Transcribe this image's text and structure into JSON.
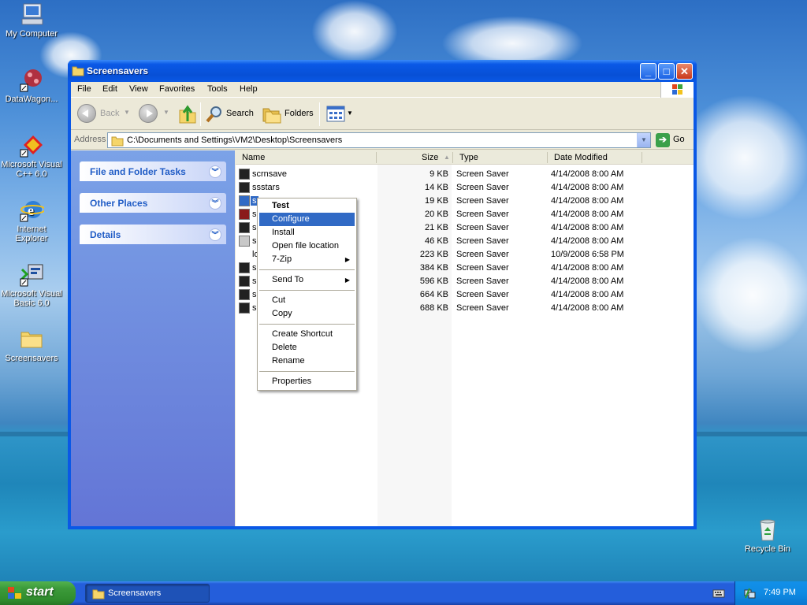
{
  "desktop": {
    "icons": [
      {
        "label": "My Computer"
      },
      {
        "label": "DataWagon..."
      },
      {
        "label": "Microsoft Visual C++ 6.0"
      },
      {
        "label": "Internet Explorer"
      },
      {
        "label": "Microsoft Visual Basic 6.0"
      },
      {
        "label": "Screensavers"
      },
      {
        "label": "Recycle Bin"
      }
    ]
  },
  "window": {
    "title": "Screensavers",
    "menu": [
      "File",
      "Edit",
      "View",
      "Favorites",
      "Tools",
      "Help"
    ],
    "toolbar": {
      "back": "Back",
      "search": "Search",
      "folders": "Folders"
    },
    "address": {
      "label": "Address",
      "value": "C:\\Documents and Settings\\VM2\\Desktop\\Screensavers",
      "go": "Go"
    },
    "tasks": [
      {
        "title": "File and Folder Tasks"
      },
      {
        "title": "Other Places"
      },
      {
        "title": "Details"
      }
    ],
    "columns": {
      "name": "Name",
      "size": "Size",
      "type": "Type",
      "date": "Date Modified"
    },
    "files": [
      {
        "name": "scrnsave",
        "size": "9 KB",
        "type": "Screen Saver",
        "date": "4/14/2008 8:00 AM"
      },
      {
        "name": "ssstars",
        "size": "14 KB",
        "type": "Screen Saver",
        "date": "4/14/2008 8:00 AM"
      },
      {
        "name": "s",
        "size": "19 KB",
        "type": "Screen Saver",
        "date": "4/14/2008 8:00 AM"
      },
      {
        "name": "s",
        "size": "20 KB",
        "type": "Screen Saver",
        "date": "4/14/2008 8:00 AM"
      },
      {
        "name": "s",
        "size": "21 KB",
        "type": "Screen Saver",
        "date": "4/14/2008 8:00 AM"
      },
      {
        "name": "s",
        "size": "46 KB",
        "type": "Screen Saver",
        "date": "4/14/2008 8:00 AM"
      },
      {
        "name": "lo",
        "size": "223 KB",
        "type": "Screen Saver",
        "date": "10/9/2008 6:58 PM"
      },
      {
        "name": "s",
        "size": "384 KB",
        "type": "Screen Saver",
        "date": "4/14/2008 8:00 AM"
      },
      {
        "name": "s",
        "size": "596 KB",
        "type": "Screen Saver",
        "date": "4/14/2008 8:00 AM"
      },
      {
        "name": "s",
        "size": "664 KB",
        "type": "Screen Saver",
        "date": "4/14/2008 8:00 AM"
      },
      {
        "name": "s",
        "size": "688 KB",
        "type": "Screen Saver",
        "date": "4/14/2008 8:00 AM"
      }
    ]
  },
  "context_menu": {
    "items": [
      "Test",
      "Configure",
      "Install",
      "Open file location",
      "7-Zip",
      "Send To",
      "Cut",
      "Copy",
      "Create Shortcut",
      "Delete",
      "Rename",
      "Properties"
    ],
    "highlighted": "Configure",
    "default": "Test"
  },
  "taskbar": {
    "start": "start",
    "task": "Screensavers",
    "clock": "7:49 PM"
  },
  "colors": {
    "titlebar": "#0a58e6",
    "selection": "#316ac5",
    "start_green": "#3c9a3a",
    "taskbar_blue": "#245edb"
  }
}
